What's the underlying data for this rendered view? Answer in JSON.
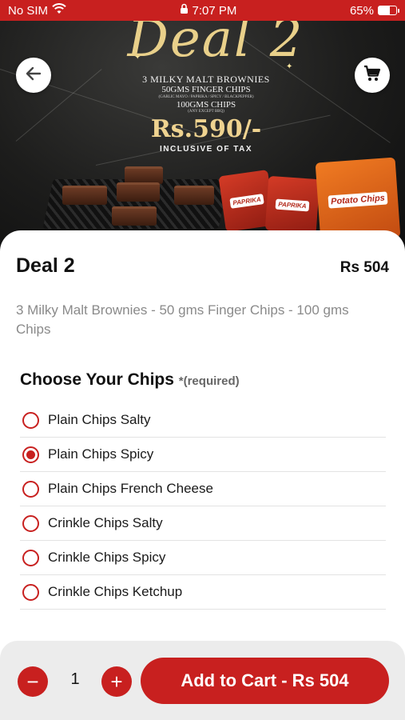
{
  "status_bar": {
    "carrier": "No SIM",
    "time": "7:07 PM",
    "battery": "65%",
    "battery_level": 0.65,
    "icons": [
      "wifi-icon",
      "lock-icon",
      "battery-icon"
    ]
  },
  "banner": {
    "title": "Deal 2",
    "line1": "3 MILKY MALT BROWNIES",
    "line2": "50GMS FINGER CHIPS",
    "line2_sub": "(GARLIC MAYO / PAPRIKA / SPICY / BLACKPEPPER)",
    "line3": "100GMS CHIPS",
    "line3_sub": "(ANY EXCEPT BBQ)",
    "price": "Rs.590/-",
    "tax_note": "INCLUSIVE OF TAX",
    "bag_labels": [
      "PAPRIKA",
      "PAPRIKA",
      "Potato Chips"
    ]
  },
  "nav": {
    "back_icon": "arrow-left-icon",
    "cart_icon": "cart-icon"
  },
  "product": {
    "name": "Deal 2",
    "price": "Rs 504",
    "description": "3 Milky Malt Brownies - 50 gms Finger Chips - 100 gms Chips"
  },
  "choice_section": {
    "title": "Choose Your Chips",
    "required_label": "*(required)",
    "selected_index": 1,
    "options": [
      {
        "label": "Plain Chips Salty"
      },
      {
        "label": "Plain Chips Spicy"
      },
      {
        "label": "Plain Chips French Cheese"
      },
      {
        "label": "Crinkle Chips Salty"
      },
      {
        "label": "Crinkle Chips Spicy"
      },
      {
        "label": "Crinkle Chips Ketchup"
      }
    ]
  },
  "cart_bar": {
    "quantity": "1",
    "minus_label": "−",
    "plus_label": "+",
    "add_button_label": "Add to Cart - Rs 504"
  },
  "colors": {
    "accent": "#c8201f",
    "text_primary": "#111111",
    "text_secondary": "#8a8a8a",
    "bottom_bar_bg": "#ececec"
  }
}
